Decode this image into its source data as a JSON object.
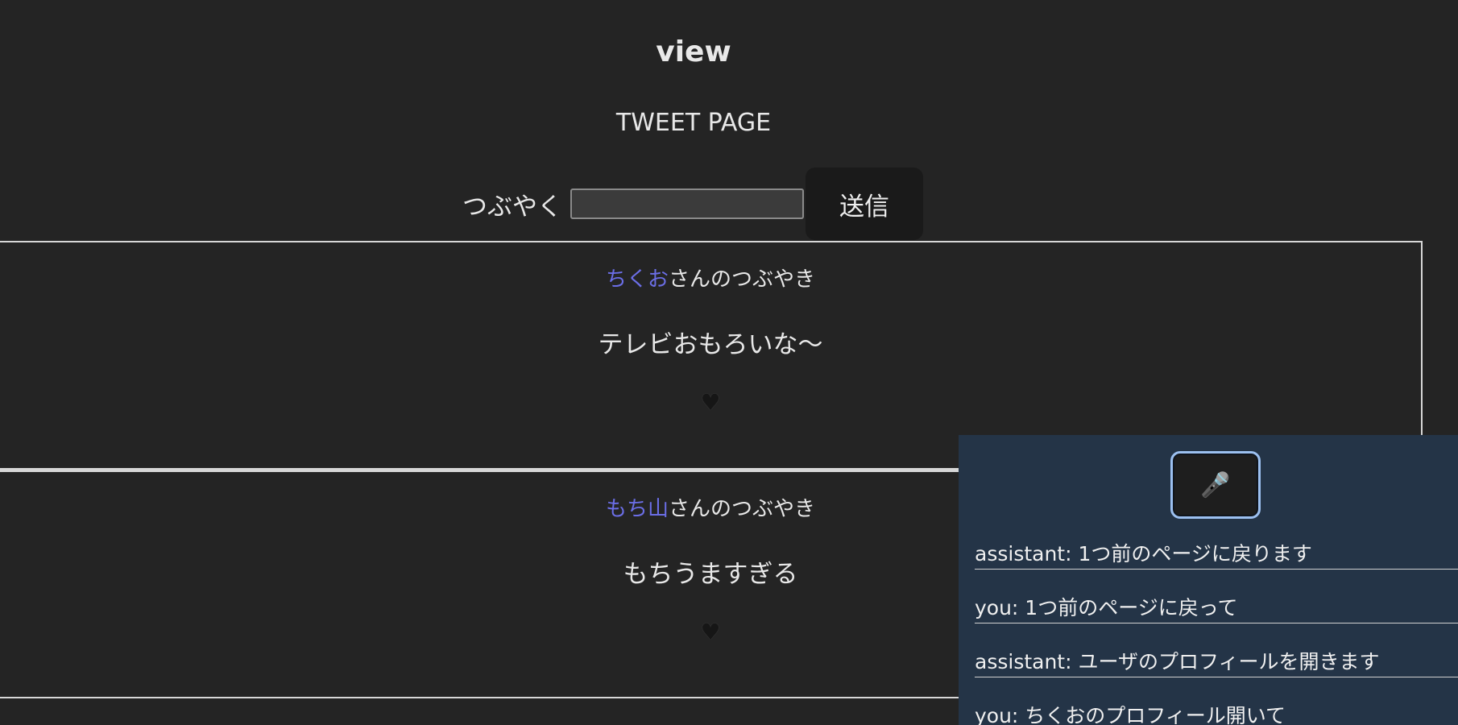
{
  "header": {
    "title": "view",
    "subtitle": "TWEET PAGE"
  },
  "form": {
    "label": "つぶやく",
    "input_value": "",
    "submit_label": "送信"
  },
  "tweets": [
    {
      "author": "ちくお",
      "suffix": "さんのつぶやき",
      "text": "テレビおもろいな〜",
      "like_icon": "♥"
    },
    {
      "author": "もち山",
      "suffix": "さんのつぶやき",
      "text": "もちうますぎる",
      "like_icon": "♥"
    }
  ],
  "assistant_panel": {
    "mic_icon": "🎤",
    "messages": [
      "assistant: 1つ前のページに戻ります",
      "you: 1つ前のページに戻って",
      "assistant: ユーザのプロフィールを開きます",
      "you: ちくおのプロフィール開いて"
    ]
  },
  "colors": {
    "background": "#242424",
    "author_link": "#6b6ee6",
    "panel": "#243447",
    "mic_border": "#9cc0f0"
  }
}
